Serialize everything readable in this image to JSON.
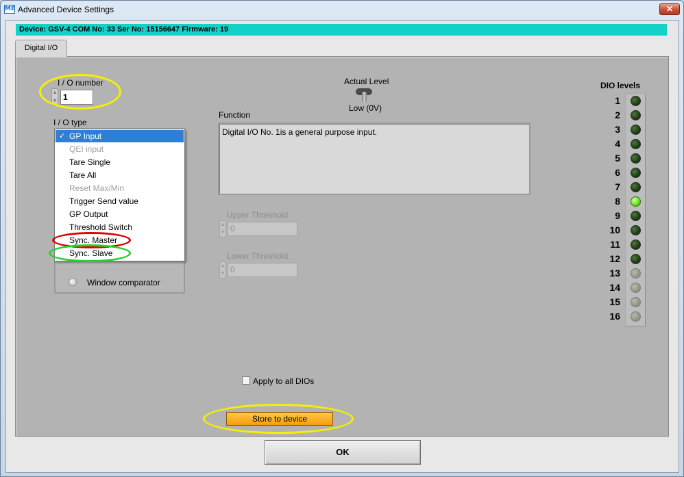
{
  "window": {
    "title": "Advanced Device Settings",
    "app_icon": "ME",
    "close_glyph": "✕"
  },
  "device_info": "Device: GSV-4 COM No: 33 Ser No: 15156647 Firmware: 19",
  "tab": {
    "label": "Digital I/O"
  },
  "io_number": {
    "label": "I / O number",
    "value": "1"
  },
  "io_type": {
    "label": "I / O type",
    "options": [
      {
        "label": "GP Input",
        "selected": true,
        "enabled": true
      },
      {
        "label": "QEI input",
        "selected": false,
        "enabled": false
      },
      {
        "label": "Tare Single",
        "selected": false,
        "enabled": true
      },
      {
        "label": "Tare All",
        "selected": false,
        "enabled": true
      },
      {
        "label": "Reset Max/Min",
        "selected": false,
        "enabled": false
      },
      {
        "label": "Trigger Send value",
        "selected": false,
        "enabled": true
      },
      {
        "label": "GP Output",
        "selected": false,
        "enabled": true
      },
      {
        "label": "Threshold Switch",
        "selected": false,
        "enabled": true
      },
      {
        "label": "Sync. Master",
        "selected": false,
        "enabled": true
      },
      {
        "label": "Sync. Slave",
        "selected": false,
        "enabled": true
      }
    ],
    "window_comparator": "Window comparator"
  },
  "actual_level": {
    "label": "Actual Level",
    "state": "Low (0V)"
  },
  "function": {
    "label": "Function",
    "text": "Digital I/O No. 1is a general purpose input."
  },
  "upper_threshold": {
    "label": "Upper Threshold",
    "value": "0"
  },
  "lower_threshold": {
    "label": "Lower Threshold",
    "value": "0"
  },
  "dio_levels": {
    "title": "DIO levels",
    "channels": [
      {
        "n": "1",
        "state": "off"
      },
      {
        "n": "2",
        "state": "off"
      },
      {
        "n": "3",
        "state": "off"
      },
      {
        "n": "4",
        "state": "off"
      },
      {
        "n": "5",
        "state": "off"
      },
      {
        "n": "6",
        "state": "off"
      },
      {
        "n": "7",
        "state": "off"
      },
      {
        "n": "8",
        "state": "on"
      },
      {
        "n": "9",
        "state": "off"
      },
      {
        "n": "10",
        "state": "off"
      },
      {
        "n": "11",
        "state": "off"
      },
      {
        "n": "12",
        "state": "off"
      },
      {
        "n": "13",
        "state": "na"
      },
      {
        "n": "14",
        "state": "na"
      },
      {
        "n": "15",
        "state": "na"
      },
      {
        "n": "16",
        "state": "na"
      }
    ]
  },
  "apply_all": {
    "label": "Apply to all DIOs",
    "checked": false
  },
  "store_button": "Store to device",
  "ok_button": "OK",
  "colors": {
    "device_bar": "#14d1c7",
    "store_button": "#f5a614",
    "led_on": "#5fdc1e",
    "highlight_yellow": "#f5f000",
    "highlight_red": "#e00000",
    "highlight_green": "#22d32a"
  }
}
